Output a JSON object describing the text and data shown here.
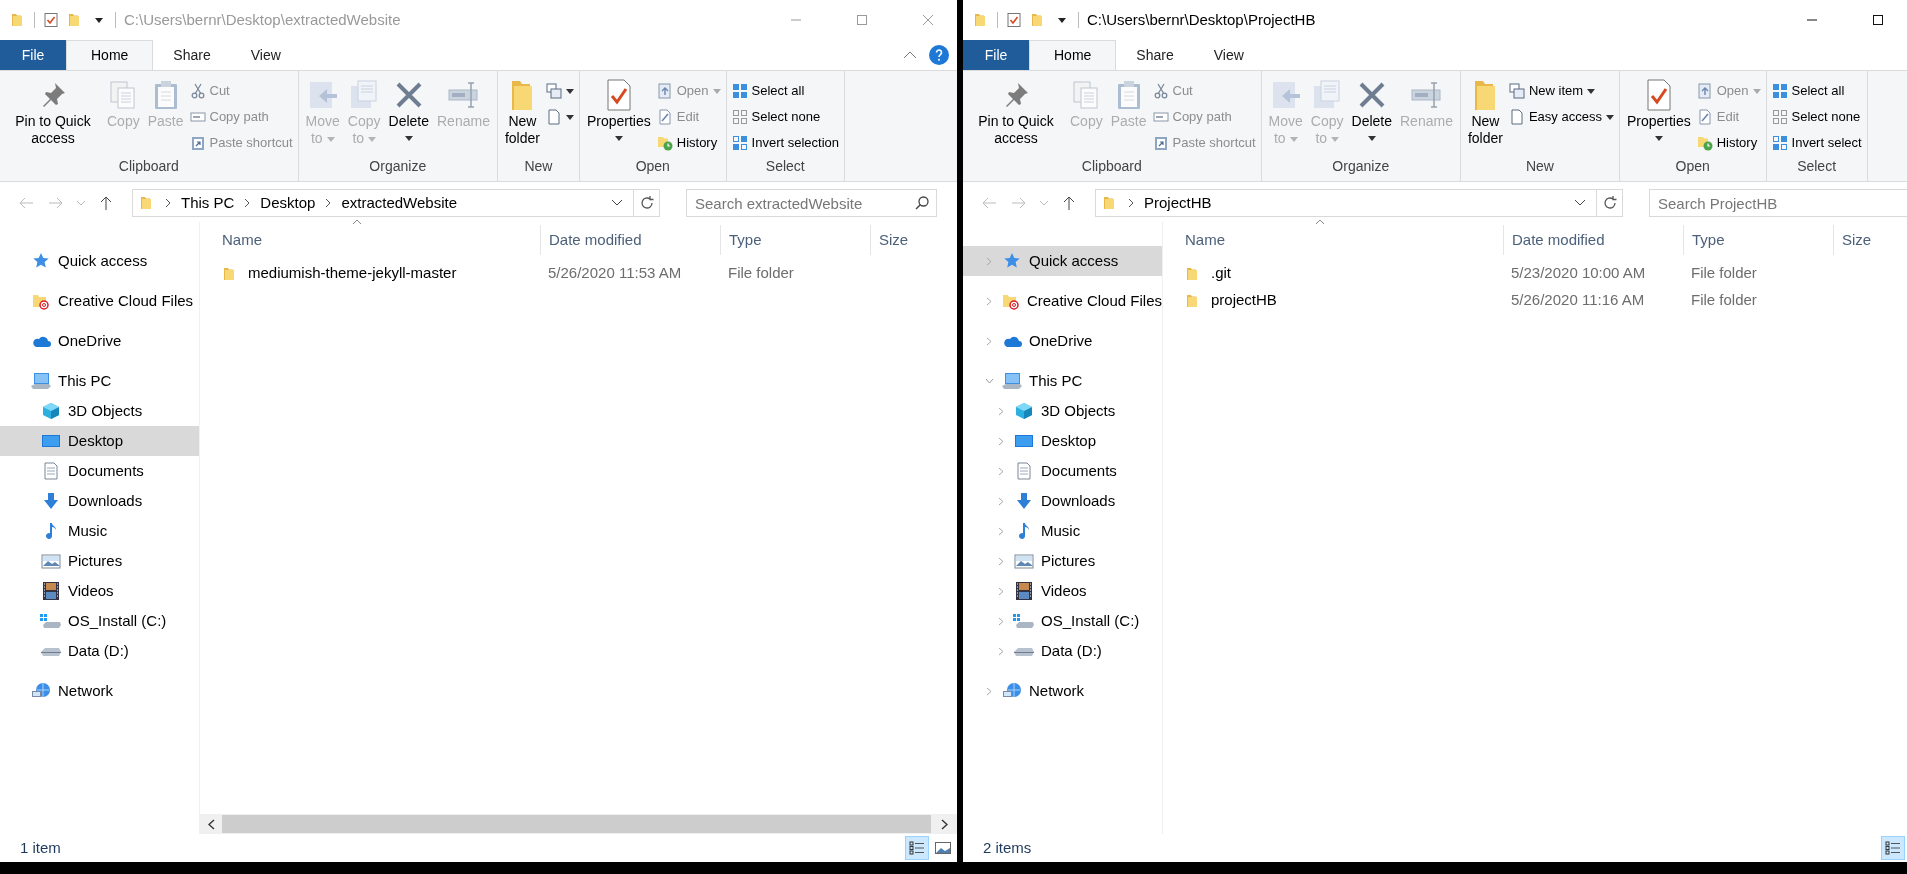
{
  "windows": [
    {
      "active": false,
      "title": "C:\\Users\\bernr\\Desktop\\extractedWebsite",
      "controls": [
        {
          "kind": "minimize"
        },
        {
          "kind": "maximize"
        },
        {
          "kind": "close"
        }
      ],
      "tabs": [
        {
          "label": "File",
          "kind": "menu",
          "selected": false
        },
        {
          "label": "Home",
          "kind": "tab",
          "selected": true
        },
        {
          "label": "Share",
          "kind": "tab",
          "selected": false
        },
        {
          "label": "View",
          "kind": "tab",
          "selected": false
        }
      ],
      "help_button": true,
      "ribbon": [
        {
          "label": "Clipboard",
          "columns": [
            {
              "kind": "large",
              "label": "Pin to Quick access",
              "disabled": false,
              "dropdown": false
            },
            {
              "kind": "large",
              "label": "Copy",
              "disabled": true,
              "dropdown": false
            },
            {
              "kind": "large",
              "label": "Paste",
              "disabled": true,
              "dropdown": false
            },
            {
              "kind": "small",
              "rows": [
                {
                  "label": "Cut",
                  "disabled": true,
                  "dropdown": false
                },
                {
                  "label": "Copy path",
                  "disabled": true,
                  "dropdown": false
                },
                {
                  "label": "Paste shortcut",
                  "disabled": true,
                  "dropdown": false
                }
              ]
            }
          ]
        },
        {
          "label": "Organize",
          "columns": [
            {
              "kind": "stacked",
              "label": "Move to",
              "disabled": true,
              "dropdown": true
            },
            {
              "kind": "stacked",
              "label": "Copy to",
              "disabled": true,
              "dropdown": true
            },
            {
              "kind": "large",
              "label": "Delete",
              "disabled": false,
              "dropdown": true
            },
            {
              "kind": "large",
              "label": "Rename",
              "disabled": true,
              "dropdown": false
            }
          ]
        },
        {
          "label": "New",
          "columns": [
            {
              "kind": "stacked",
              "label": "New folder",
              "disabled": false,
              "dropdown": false
            },
            {
              "kind": "small",
              "rows": [
                {
                  "disabled": false,
                  "dropdown": true
                },
                {
                  "disabled": false,
                  "dropdown": true
                }
              ]
            }
          ]
        },
        {
          "label": "Open",
          "columns": [
            {
              "kind": "large",
              "label": "Properties",
              "disabled": false,
              "dropdown": true
            },
            {
              "kind": "small",
              "rows": [
                {
                  "label": "Open",
                  "disabled": true,
                  "dropdown": true
                },
                {
                  "label": "Edit",
                  "disabled": true,
                  "dropdown": false
                },
                {
                  "label": "History",
                  "disabled": false,
                  "dropdown": false
                }
              ]
            }
          ]
        },
        {
          "label": "Select",
          "columns": [
            {
              "kind": "small",
              "rows": [
                {
                  "label": "Select all",
                  "disabled": false,
                  "dropdown": false
                },
                {
                  "label": "Select none",
                  "disabled": false,
                  "dropdown": false
                },
                {
                  "label": "Invert selection",
                  "disabled": false,
                  "dropdown": false
                }
              ]
            }
          ]
        }
      ],
      "crumbs": [
        "This PC",
        "Desktop",
        "extractedWebsite"
      ],
      "search_placeholder": "Search extractedWebsite",
      "search_icon": true,
      "nav": [
        {
          "label": "Quick access",
          "selected": false
        },
        {
          "label": "Creative Cloud Files",
          "selected": false
        },
        {
          "label": "OneDrive",
          "selected": false
        },
        {
          "label": "This PC",
          "selected": false,
          "children": [
            {
              "label": "3D Objects",
              "selected": false
            },
            {
              "label": "Desktop",
              "selected": true
            },
            {
              "label": "Documents",
              "selected": false
            },
            {
              "label": "Downloads",
              "selected": false
            },
            {
              "label": "Music",
              "selected": false
            },
            {
              "label": "Pictures",
              "selected": false
            },
            {
              "label": "Videos",
              "selected": false
            },
            {
              "label": "OS_Install (C:)",
              "selected": false
            },
            {
              "label": "Data (D:)",
              "selected": false
            }
          ]
        },
        {
          "label": "Network",
          "selected": false
        }
      ],
      "columns": [
        "Name",
        "Date modified",
        "Type",
        "Size"
      ],
      "files": [
        {
          "name": "mediumish-theme-jekyll-master",
          "date": "5/26/2020 11:53 AM",
          "type": "File folder"
        }
      ],
      "h_scrollbar": true,
      "status": "1 item",
      "views": [
        {
          "kind": "details",
          "selected": true
        },
        {
          "kind": "large_icons",
          "selected": false
        }
      ]
    },
    {
      "active": true,
      "title": "C:\\Users\\bernr\\Desktop\\ProjectHB",
      "controls": [
        {
          "kind": "minimize"
        },
        {
          "kind": "maximize"
        }
      ],
      "tabs": [
        {
          "label": "File",
          "kind": "menu",
          "selected": false
        },
        {
          "label": "Home",
          "kind": "tab",
          "selected": true
        },
        {
          "label": "Share",
          "kind": "tab",
          "selected": false
        },
        {
          "label": "View",
          "kind": "tab",
          "selected": false
        }
      ],
      "help_button": false,
      "ribbon": [
        {
          "label": "Clipboard",
          "columns": [
            {
              "kind": "large",
              "label": "Pin to Quick access",
              "disabled": false,
              "dropdown": false
            },
            {
              "kind": "large",
              "label": "Copy",
              "disabled": true,
              "dropdown": false
            },
            {
              "kind": "large",
              "label": "Paste",
              "disabled": true,
              "dropdown": false
            },
            {
              "kind": "small",
              "rows": [
                {
                  "label": "Cut",
                  "disabled": true,
                  "dropdown": false
                },
                {
                  "label": "Copy path",
                  "disabled": true,
                  "dropdown": false
                },
                {
                  "label": "Paste shortcut",
                  "disabled": true,
                  "dropdown": false
                }
              ]
            }
          ]
        },
        {
          "label": "Organize",
          "columns": [
            {
              "kind": "stacked",
              "label": "Move to",
              "disabled": true,
              "dropdown": true
            },
            {
              "kind": "stacked",
              "label": "Copy to",
              "disabled": true,
              "dropdown": true
            },
            {
              "kind": "large",
              "label": "Delete",
              "disabled": false,
              "dropdown": true
            },
            {
              "kind": "large",
              "label": "Rename",
              "disabled": true,
              "dropdown": false
            }
          ]
        },
        {
          "label": "New",
          "columns": [
            {
              "kind": "stacked",
              "label": "New folder",
              "disabled": false,
              "dropdown": false
            },
            {
              "kind": "small",
              "rows": [
                {
                  "label": "New item",
                  "disabled": false,
                  "dropdown": true
                },
                {
                  "label": "Easy access",
                  "disabled": false,
                  "dropdown": true
                }
              ]
            }
          ]
        },
        {
          "label": "Open",
          "columns": [
            {
              "kind": "large",
              "label": "Properties",
              "disabled": false,
              "dropdown": true
            },
            {
              "kind": "small",
              "rows": [
                {
                  "label": "Open",
                  "disabled": true,
                  "dropdown": true
                },
                {
                  "label": "Edit",
                  "disabled": true,
                  "dropdown": false
                },
                {
                  "label": "History",
                  "disabled": false,
                  "dropdown": false
                }
              ]
            }
          ]
        },
        {
          "label": "Select",
          "columns": [
            {
              "kind": "small",
              "rows": [
                {
                  "label": "Select all",
                  "disabled": false,
                  "dropdown": false
                },
                {
                  "label": "Select none",
                  "disabled": false,
                  "dropdown": false
                },
                {
                  "label": "Invert select",
                  "disabled": false,
                  "dropdown": false
                }
              ]
            }
          ]
        }
      ],
      "crumbs": [
        "ProjectHB"
      ],
      "search_placeholder": "Search ProjectHB",
      "search_icon": false,
      "nav": [
        {
          "label": "Quick access",
          "selected": true,
          "expanded": false
        },
        {
          "label": "Creative Cloud Files",
          "selected": false,
          "expanded": false
        },
        {
          "label": "OneDrive",
          "selected": false,
          "expanded": false
        },
        {
          "label": "This PC",
          "selected": false,
          "expanded": true,
          "children": [
            {
              "label": "3D Objects",
              "selected": false,
              "expanded": false
            },
            {
              "label": "Desktop",
              "selected": false,
              "expanded": false
            },
            {
              "label": "Documents",
              "selected": false,
              "expanded": false
            },
            {
              "label": "Downloads",
              "selected": false,
              "expanded": false
            },
            {
              "label": "Music",
              "selected": false,
              "expanded": false
            },
            {
              "label": "Pictures",
              "selected": false,
              "expanded": false
            },
            {
              "label": "Videos",
              "selected": false,
              "expanded": false
            },
            {
              "label": "OS_Install (C:)",
              "selected": false,
              "expanded": false
            },
            {
              "label": "Data (D:)",
              "selected": false,
              "expanded": false
            }
          ]
        },
        {
          "label": "Network",
          "selected": false,
          "expanded": false
        }
      ],
      "columns": [
        "Name",
        "Date modified",
        "Type",
        "Size"
      ],
      "files": [
        {
          "name": ".git",
          "date": "5/23/2020 10:00 AM",
          "type": "File folder"
        },
        {
          "name": "projectHB",
          "date": "5/26/2020 11:16 AM",
          "type": "File folder"
        }
      ],
      "h_scrollbar": false,
      "status": "2 items",
      "views": [
        {
          "kind": "details",
          "selected": true
        }
      ]
    }
  ]
}
